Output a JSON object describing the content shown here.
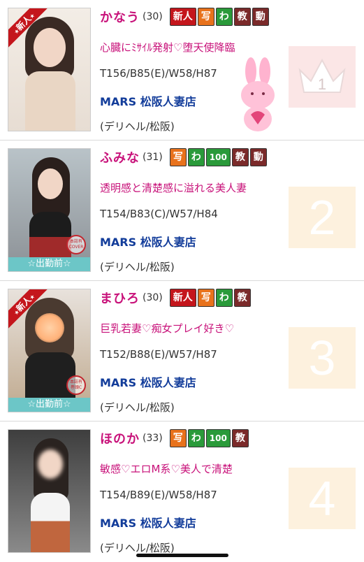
{
  "listings": [
    {
      "name": "かなう",
      "age": "(30)",
      "badges": [
        "新人",
        "写",
        "わ",
        "教",
        "動"
      ],
      "catchphrase": "心臓にﾐｻｲﾙ発射♡堕天使降臨",
      "spec": "T156/B85(E)/W58/H87",
      "shop": "MARS 松阪人妻店",
      "area": "(デリヘル/松阪)",
      "photo_ribbon": "新人",
      "rank": "1"
    },
    {
      "name": "ふみな",
      "age": "(31)",
      "badges": [
        "写",
        "わ",
        "100",
        "教",
        "動"
      ],
      "catchphrase": "透明感と清楚感に溢れる美人妻",
      "spec": "T154/B83(C)/W57/H84",
      "shop": "MARS 松阪人妻店",
      "area": "(デリヘル/松阪)",
      "photo_banner": "☆出勤前☆",
      "stamp": "本誌有 COVER",
      "rank": "2"
    },
    {
      "name": "まひろ",
      "age": "(30)",
      "badges": [
        "新人",
        "写",
        "わ",
        "教"
      ],
      "catchphrase": "巨乳若妻♡痴女プレイ好き♡",
      "spec": "T152/B88(E)/W57/H87",
      "shop": "MARS 松阪人妻店",
      "area": "(デリヘル/松阪)",
      "photo_ribbon": "新人",
      "photo_banner": "☆出勤前☆",
      "stamp": "本誌有 巻頭C",
      "rank": "3"
    },
    {
      "name": "ほのか",
      "age": "(33)",
      "badges": [
        "写",
        "わ",
        "100",
        "教"
      ],
      "catchphrase": "敏感♡エロM系♡美人で清楚",
      "spec": "T154/B89(E)/W58/H87",
      "shop": "MARS 松阪人妻店",
      "area": "(デリヘル/松阪)",
      "rank": "4"
    }
  ]
}
